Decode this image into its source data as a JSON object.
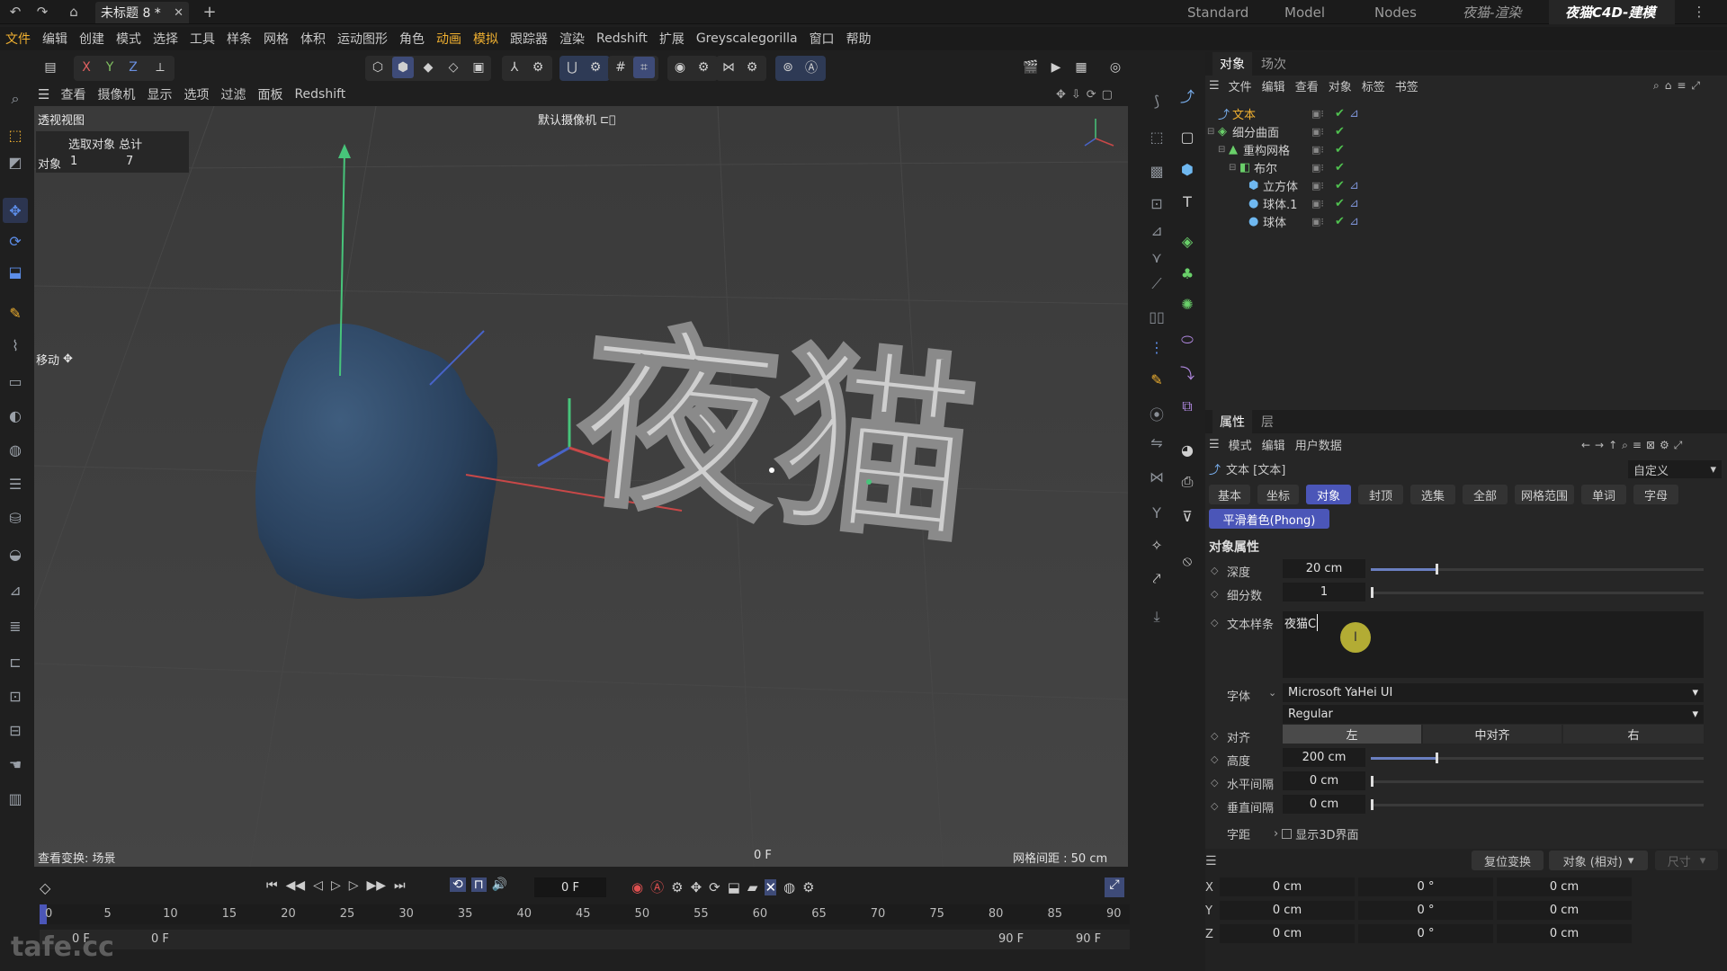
{
  "titlebar": {
    "doc_tab": "未标题 8 *",
    "layouts": [
      "Standard",
      "Model",
      "Nodes",
      "夜猫-渲染",
      "夜猫C4D-建模"
    ]
  },
  "menubar": [
    "文件",
    "编辑",
    "创建",
    "模式",
    "选择",
    "工具",
    "样条",
    "网格",
    "体积",
    "运动图形",
    "角色",
    "动画",
    "模拟",
    "跟踪器",
    "渲染",
    "Redshift",
    "扩展",
    "Greyscalegorilla",
    "窗口",
    "帮助"
  ],
  "axis_lock": [
    "X",
    "Y",
    "Z"
  ],
  "viewport": {
    "menu": [
      "查看",
      "摄像机",
      "显示",
      "选项",
      "过滤",
      "面板",
      "Redshift"
    ],
    "view_name": "透视视图",
    "camera": "默认摄像机",
    "info_header": "选取对象 总计",
    "info_label": "对象",
    "info_selected": "1",
    "info_total": "7",
    "tool_label": "移动",
    "status_left": "查看变换: 场景",
    "status_frame": "0 F",
    "status_grid": "网格间距 : 50 cm",
    "text_3d": "夜猫"
  },
  "timeline": {
    "current_frame": "0 F",
    "ticks": [
      "0",
      "5",
      "10",
      "15",
      "20",
      "25",
      "30",
      "35",
      "40",
      "45",
      "50",
      "55",
      "60",
      "65",
      "70",
      "75",
      "80",
      "85",
      "90"
    ],
    "start_a": "0 F",
    "start_b": "0 F",
    "end_a": "90 F",
    "end_b": "90 F"
  },
  "watermark": "tafe.cc",
  "object_manager": {
    "tabs": [
      "对象",
      "场次"
    ],
    "menu": [
      "文件",
      "编辑",
      "查看",
      "对象",
      "标签",
      "书签"
    ],
    "objects": [
      {
        "name": "文本",
        "indent": 0,
        "color": "#f0b030"
      },
      {
        "name": "细分曲面",
        "indent": 0,
        "color": "#d0d0d0"
      },
      {
        "name": "重构网格",
        "indent": 1,
        "color": "#d0d0d0"
      },
      {
        "name": "布尔",
        "indent": 2,
        "color": "#d0d0d0"
      },
      {
        "name": "立方体",
        "indent": 3,
        "color": "#d0d0d0"
      },
      {
        "name": "球体.1",
        "indent": 3,
        "color": "#d0d0d0"
      },
      {
        "name": "球体",
        "indent": 3,
        "color": "#d0d0d0"
      }
    ]
  },
  "attributes": {
    "tabs": [
      "属性",
      "层"
    ],
    "menu": [
      "模式",
      "编辑",
      "用户数据"
    ],
    "object_title": "文本 [文本]",
    "preset": "自定义",
    "subtabs": [
      "基本",
      "坐标",
      "对象",
      "封顶",
      "选集",
      "全部",
      "网格范围",
      "单词",
      "字母"
    ],
    "phong_tab": "平滑着色(Phong)",
    "section": "对象属性",
    "depth_label": "深度",
    "depth": "20 cm",
    "subdiv_label": "细分数",
    "subdiv": "1",
    "text_label": "文本样条",
    "text_value": "夜猫C",
    "font_label": "字体",
    "font": "Microsoft YaHei UI",
    "font_style": "Regular",
    "align_label": "对齐",
    "align_options": [
      "左",
      "中对齐",
      "右"
    ],
    "height_label": "高度",
    "height": "200 cm",
    "hspace_label": "水平间隔",
    "hspace": "0 cm",
    "vspace_label": "垂直间隔",
    "vspace": "0 cm",
    "kerning_label": "字距",
    "show3d": "显示3D界面",
    "reset_btn": "复位变换",
    "coord_mode": "对象 (相对)",
    "size_label": "尺寸",
    "coords": [
      {
        "axis": "X",
        "pos": "0 cm",
        "rot": "0 °",
        "size": "0 cm"
      },
      {
        "axis": "Y",
        "pos": "0 cm",
        "rot": "0 °",
        "size": "0 cm"
      },
      {
        "axis": "Z",
        "pos": "0 cm",
        "rot": "0 °",
        "size": "0 cm"
      }
    ]
  },
  "colors": {
    "accent": "#4b56b8",
    "selected_text": "#f0b030",
    "check": "#4fc04f"
  }
}
